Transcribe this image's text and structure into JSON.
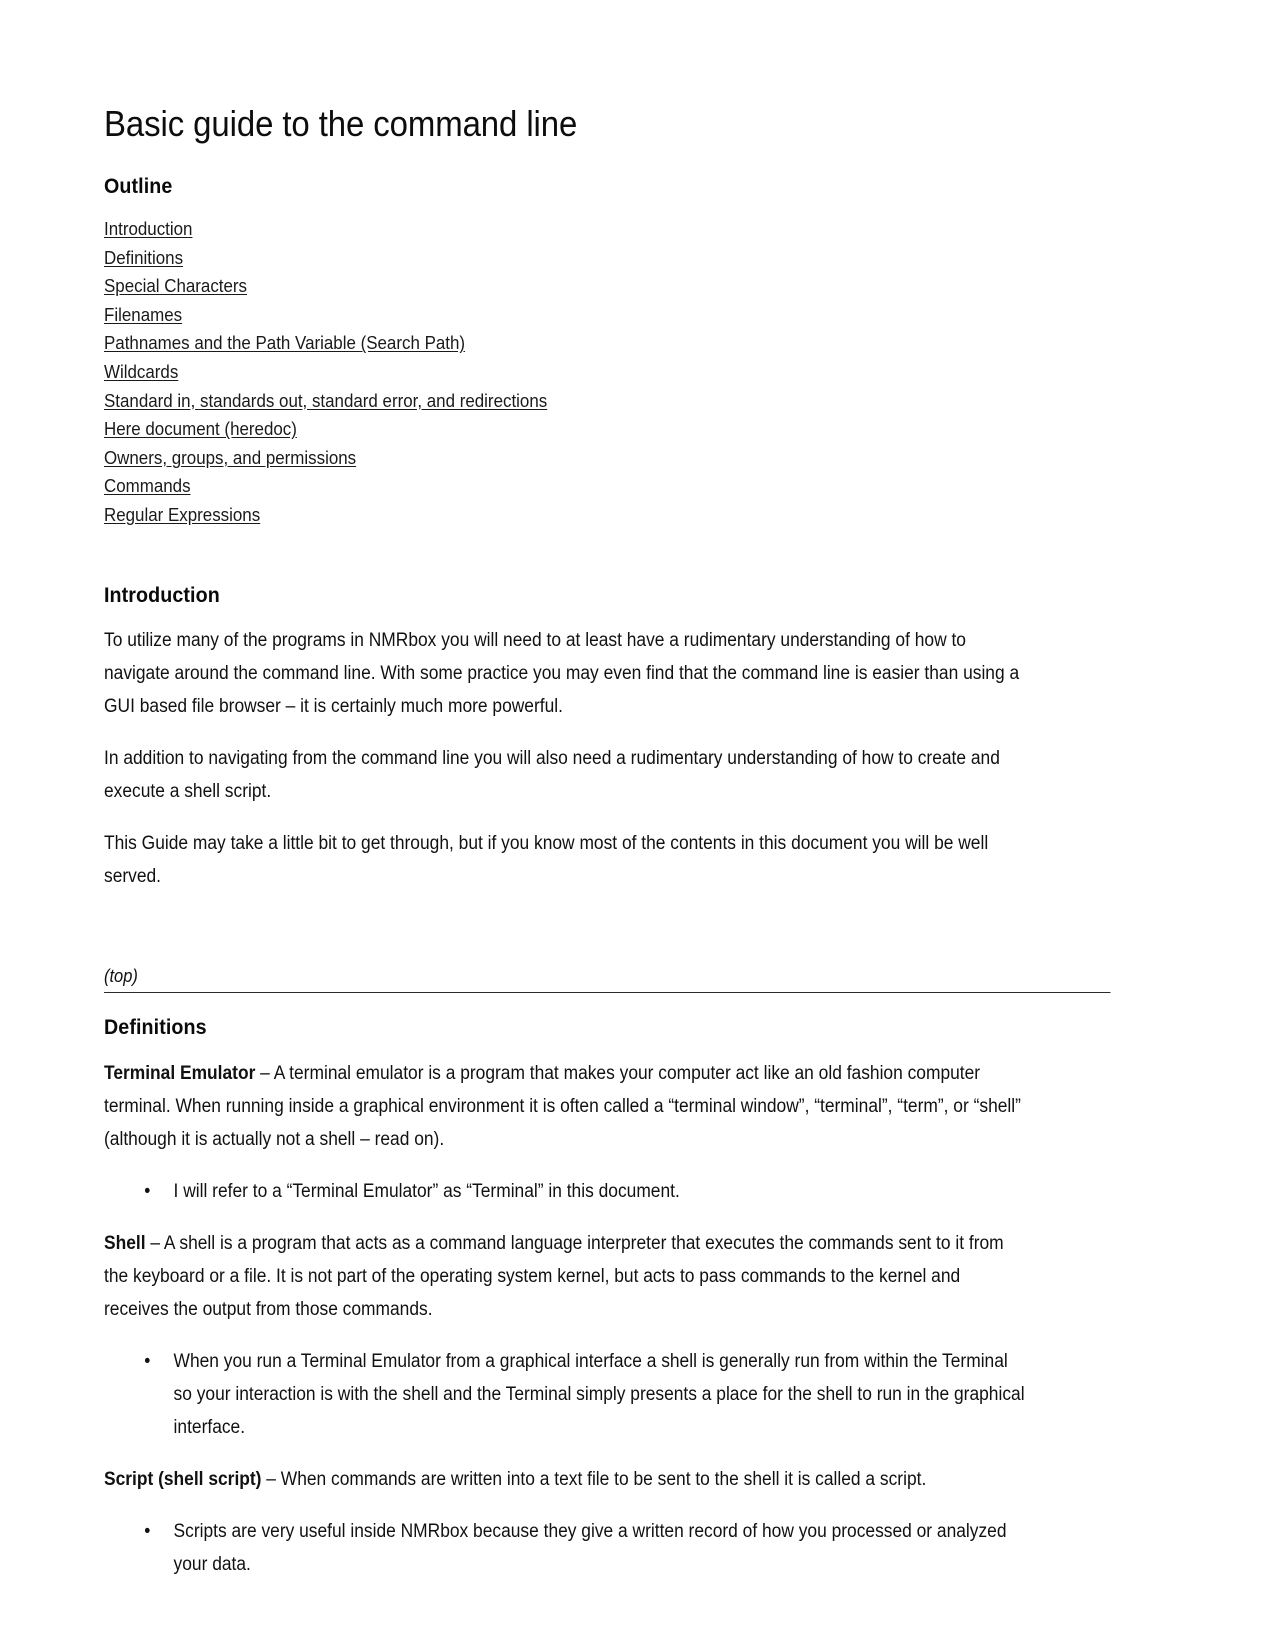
{
  "document": {
    "title": "Basic guide to the command line"
  },
  "outline": {
    "heading": "Outline",
    "links": [
      {
        "label": "Introduction"
      },
      {
        "label": "Definitions"
      },
      {
        "label": "Special Characters"
      },
      {
        "label": "Filenames"
      },
      {
        "label": "Pathnames and the Path Variable (Search Path)"
      },
      {
        "label": "Wildcards"
      },
      {
        "label": "Standard in, standards out, standard error, and redirections"
      },
      {
        "label": "Here document (heredoc)"
      },
      {
        "label": "Owners, groups, and permissions"
      },
      {
        "label": "Commands"
      },
      {
        "label": "Regular Expressions"
      }
    ]
  },
  "introduction": {
    "heading": "Introduction",
    "paragraphs": [
      "To utilize many of the programs in NMRbox you will need to at least have a rudimentary understanding of how to navigate around the command line. With some practice you may even find that the command line is easier than using a GUI based file browser – it is certainly much more powerful.",
      "In addition to navigating from the command line you will also need a rudimentary understanding of how to create and execute a shell script.",
      "This Guide may take a little bit to get through, but if you know most of the contents in this document you will be well served."
    ]
  },
  "top_marker": {
    "label": "(top)"
  },
  "definitions": {
    "heading": "Definitions",
    "entries": [
      {
        "term": "Terminal Emulator",
        "text": " – A terminal emulator is a program that makes your computer act like an old fashion computer terminal. When running inside a graphical environment it is often called a “terminal window”, “terminal”, “term”, or “shell” (although it is actually not a shell – read on).",
        "bullets": [
          "I will refer to a “Terminal Emulator” as “Terminal” in this document."
        ]
      },
      {
        "term": "Shell",
        "text": " – A shell is a program that acts as a command language interpreter that executes the commands sent to it from the keyboard or a file. It is not part of the operating system kernel, but acts to pass commands to the kernel and receives the output from those commands.",
        "bullets": [
          "When you run a Terminal Emulator from a graphical interface a shell is generally run from within the Terminal so your interaction is with the shell and the Terminal simply presents a place for the shell to run in the graphical interface."
        ]
      },
      {
        "term": "Script (shell script)",
        "text": " – When commands are written into a text file to be sent to the shell it is called a script.",
        "bullets": [
          "Scripts are very useful inside NMRbox because they give a written record of how you processed or analyzed your data."
        ]
      }
    ]
  },
  "symbols": {
    "bullet": "•"
  }
}
